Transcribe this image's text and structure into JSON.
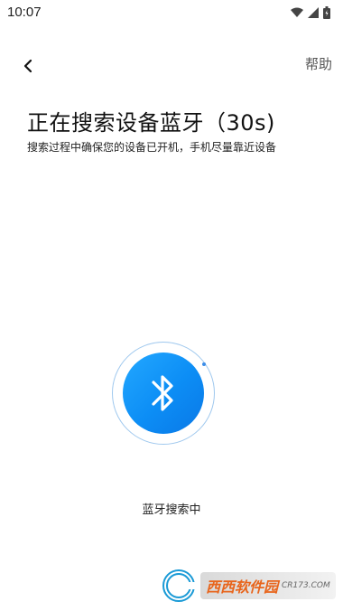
{
  "status_bar": {
    "time": "10:07",
    "icons": [
      "wifi-icon",
      "signal-icon",
      "battery-icon"
    ]
  },
  "nav": {
    "back_icon": "chevron-left-icon",
    "help_label": "帮助"
  },
  "header": {
    "title": "正在搜索设备蓝牙（30s)",
    "subtitle": "搜索过程中确保您的设备已开机，手机尽量靠近设备"
  },
  "scan": {
    "icon": "bluetooth-icon",
    "status_text": "蓝牙搜索中",
    "colors": {
      "accent": "#1196fa",
      "ring": "#9fc8ee"
    }
  },
  "watermark": {
    "brand": "西西软件园",
    "domain": "CR173.COM"
  }
}
